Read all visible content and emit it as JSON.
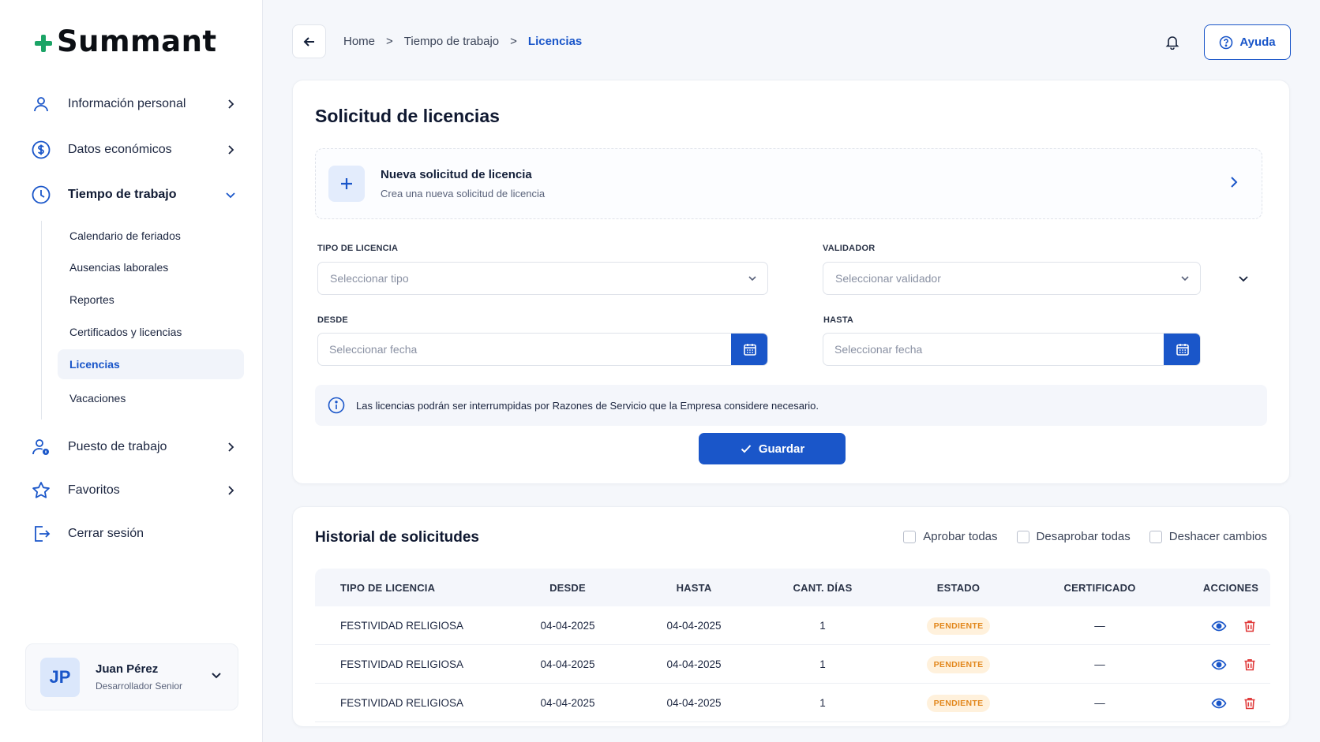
{
  "brand": {
    "name": "Summant",
    "accent": "#1ba466",
    "primary": "#1a56c9"
  },
  "sidebar": {
    "items": [
      {
        "label": "Información personal",
        "icon": "user-icon"
      },
      {
        "label": "Datos económicos",
        "icon": "dollar-circle-icon"
      },
      {
        "label": "Tiempo de trabajo",
        "icon": "clock-icon"
      },
      {
        "label": "Puesto de trabajo",
        "icon": "user-badge-icon"
      },
      {
        "label": "Favoritos",
        "icon": "star-icon"
      },
      {
        "label": "Cerrar sesión",
        "icon": "logout-icon"
      }
    ],
    "subitems": [
      {
        "label": "Calendario de feriados"
      },
      {
        "label": "Ausencias laborales"
      },
      {
        "label": "Reportes"
      },
      {
        "label": "Certificados y licencias"
      },
      {
        "label": "Licencias"
      },
      {
        "label": "Vacaciones"
      }
    ],
    "user": {
      "initials": "JP",
      "name": "Juan Pérez",
      "role": "Desarrollador Senior"
    }
  },
  "topbar": {
    "breadcrumb": [
      "Home",
      "Tiempo de trabajo",
      "Licencias"
    ],
    "separator": ">",
    "help_label": "Ayuda"
  },
  "form": {
    "title": "Solicitud de licencias",
    "new_request": {
      "title": "Nueva solicitud de licencia",
      "subtitle": "Crea una nueva solicitud de licencia"
    },
    "tipo_label": "TIPO DE LICENCIA",
    "tipo_placeholder": "Seleccionar tipo",
    "validador_label": "VALIDADOR",
    "validador_placeholder": "Seleccionar validador",
    "desde_label": "DESDE",
    "desde_placeholder": "Seleccionar fecha",
    "hasta_label": "HASTA",
    "hasta_placeholder": "Seleccionar fecha",
    "info": "Las licencias podrán ser interrumpidas por Razones de Servicio que la Empresa considere necesario.",
    "save_label": "Guardar"
  },
  "history": {
    "title": "Historial de solicitudes",
    "actions": [
      "Aprobar todas",
      "Desaprobar todas",
      "Deshacer cambios"
    ],
    "columns": [
      "TIPO DE LICENCIA",
      "DESDE",
      "HASTA",
      "CANT. DÍAS",
      "ESTADO",
      "CERTIFICADO",
      "ACCIONES"
    ],
    "rows": [
      {
        "tipo": "FESTIVIDAD RELIGIOSA",
        "desde": "04-04-2025",
        "hasta": "04-04-2025",
        "dias": "1",
        "estado": "PENDIENTE",
        "certificado": "—"
      },
      {
        "tipo": "FESTIVIDAD RELIGIOSA",
        "desde": "04-04-2025",
        "hasta": "04-04-2025",
        "dias": "1",
        "estado": "PENDIENTE",
        "certificado": "—"
      },
      {
        "tipo": "FESTIVIDAD RELIGIOSA",
        "desde": "04-04-2025",
        "hasta": "04-04-2025",
        "dias": "1",
        "estado": "PENDIENTE",
        "certificado": "—"
      }
    ]
  }
}
